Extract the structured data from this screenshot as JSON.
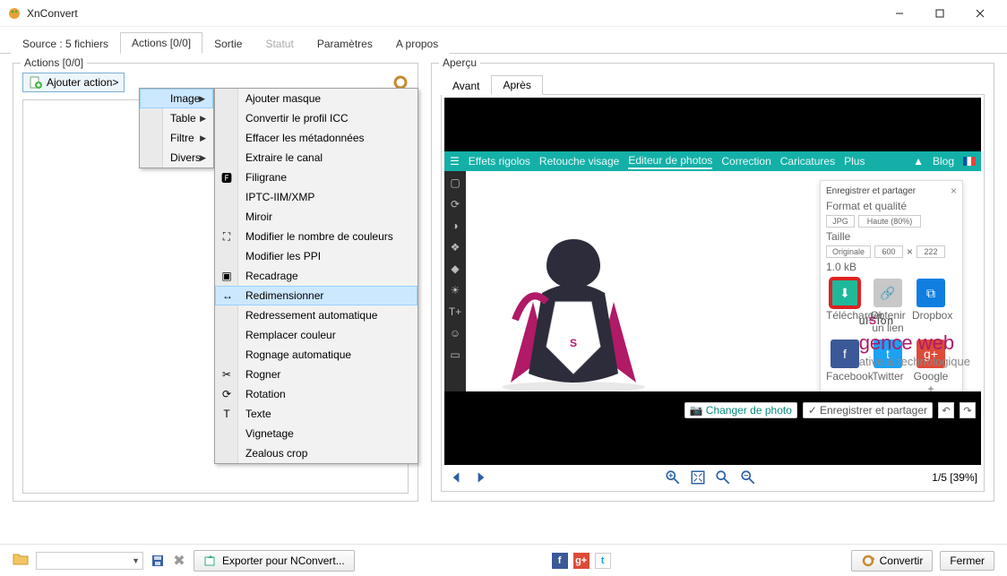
{
  "window": {
    "title": "XnConvert"
  },
  "tabs": {
    "source": "Source : 5 fichiers",
    "actions": "Actions [0/0]",
    "output": "Sortie",
    "status": "Statut",
    "params": "Paramètres",
    "about": "A propos"
  },
  "actions_group": {
    "label": "Actions [0/0]",
    "add_action": "Ajouter action>"
  },
  "menu1": {
    "image": "Image",
    "table": "Table",
    "filter": "Filtre",
    "misc": "Divers"
  },
  "menu2": {
    "items": [
      "Ajouter masque",
      "Convertir le profil ICC",
      "Effacer les métadonnées",
      "Extraire le canal",
      "Filigrane",
      "IPTC-IIM/XMP",
      "Miroir",
      "Modifier le nombre de couleurs",
      "Modifier les PPI",
      "Recadrage",
      "Redimensionner",
      "Redressement automatique",
      "Remplacer couleur",
      "Rognage automatique",
      "Rogner",
      "Rotation",
      "Texte",
      "Vignetage",
      "Zealous crop"
    ],
    "highlight_index": 10
  },
  "preview": {
    "label": "Aperçu",
    "before": "Avant",
    "after": "Après",
    "counter": "1/5 [39%]",
    "webtop": {
      "a": "Effets rigolos",
      "b": "Retouche visage",
      "c": "Editeur de photos",
      "d": "Correction",
      "e": "Caricatures",
      "f": "Plus",
      "blog": "Blog"
    },
    "panel": {
      "title": "Enregistrer et partager",
      "fmtq": "Format et qualité",
      "jpg": "JPG",
      "quality": "Haute (80%)",
      "size": "Taille",
      "orig": "Originale",
      "w": "600",
      "h": "222",
      "info": "1.0 kB",
      "ic_dl": "Télécharger",
      "ic_link": "Obtenir un lien",
      "ic_dbx": "Dropbox",
      "ic_fb": "Facebook",
      "ic_tw": "Twitter",
      "ic_gp": "Google +"
    },
    "brand": {
      "line1a": "ul",
      "line1b": "S",
      "line1c": "ion",
      "line2": "gence web",
      "line3": "ative & technologique"
    },
    "pill_change": "Changer de photo",
    "pill_save": "Enregistrer et partager"
  },
  "bottom": {
    "export": "Exporter pour NConvert...",
    "convert": "Convertir",
    "close": "Fermer"
  }
}
